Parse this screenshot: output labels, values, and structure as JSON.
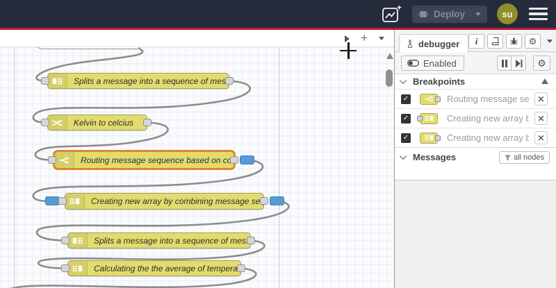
{
  "colors": {
    "header_bg": "#252b3a",
    "accent_red": "#bc1533",
    "node_yellow": "#e2dc6e",
    "breakpoint_blue": "#579ad8",
    "selected_orange": "#ff7d17",
    "avatar_olive": "#8e8e2d"
  },
  "header": {
    "deploy_label": "Deploy",
    "avatar_text": "su"
  },
  "canvas": {
    "nodes": [
      {
        "type": "split",
        "label": "Splits a message into a sequence of messages."
      },
      {
        "type": "change",
        "label": "Kelvin to celcius"
      },
      {
        "type": "switch",
        "label": "Routing message sequence based on condition"
      },
      {
        "type": "join",
        "label": "Creating new array by combining message sequence"
      },
      {
        "type": "split",
        "label": "Splits a message into a sequence of messages."
      },
      {
        "type": "join",
        "label": "Calculating the the average of temperature"
      }
    ]
  },
  "sidebar": {
    "tab_label": "debugger",
    "toolbar": {
      "enabled_label": "Enabled"
    },
    "breakpoints": {
      "title": "Breakpoints",
      "items": [
        {
          "label": "Routing message sequence based on condition"
        },
        {
          "label": "Creating new array by combining message sequence"
        },
        {
          "label": "Creating new array by combining message sequence"
        }
      ]
    },
    "messages": {
      "title": "Messages",
      "filter_label": "all nodes"
    }
  }
}
